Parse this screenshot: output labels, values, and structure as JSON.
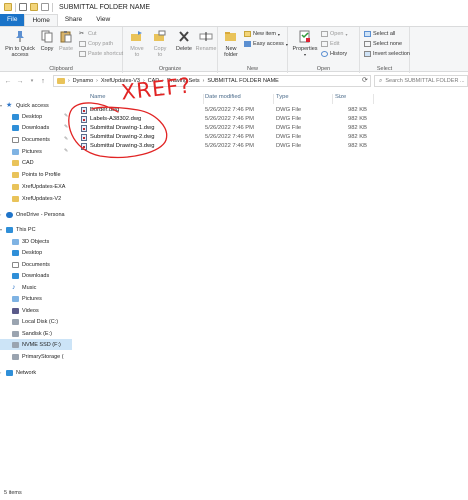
{
  "window": {
    "title": "SUBMITTAL FOLDER NAME"
  },
  "tabs": [
    {
      "label": "File"
    },
    {
      "label": "Home"
    },
    {
      "label": "Share"
    },
    {
      "label": "View"
    }
  ],
  "ribbon": {
    "clipboard": {
      "group_label": "Clipboard",
      "pin_label_1": "Pin to Quick",
      "pin_label_2": "access",
      "copy_label": "Copy",
      "paste_label": "Paste",
      "cut_label": "Cut",
      "copy_path_label": "Copy path",
      "paste_shortcut_label": "Paste shortcut"
    },
    "organize": {
      "group_label": "Organize",
      "move_to_1": "Move",
      "move_to_2": "to",
      "copy_to_1": "Copy",
      "copy_to_2": "to",
      "delete_label": "Delete",
      "rename_label": "Rename"
    },
    "new": {
      "group_label": "New",
      "new_folder_1": "New",
      "new_folder_2": "folder",
      "new_item_label": "New item",
      "easy_access_label": "Easy access"
    },
    "open": {
      "group_label": "Open",
      "properties_label": "Properties",
      "open_label": "Open",
      "edit_label": "Edit",
      "history_label": "History"
    },
    "select": {
      "group_label": "Select",
      "select_all_label": "Select all",
      "select_none_label": "Select none",
      "invert_selection_label": "Invert selection"
    }
  },
  "address": {
    "crumbs": [
      "Dynamo",
      "XrefUpdates-V3",
      "CAD",
      "Drawing Sets",
      "SUBMITTAL FOLDER NAME"
    ],
    "search_placeholder": "Search SUBMITTAL FOLDER ..."
  },
  "columns": {
    "name": "Name",
    "date": "Date modified",
    "type": "Type",
    "size": "Size"
  },
  "files": [
    {
      "name": "Border.dwg",
      "date": "5/26/2022 7:46 PM",
      "type": "DWG File",
      "size": "982 KB"
    },
    {
      "name": "Labels-A38302.dwg",
      "date": "5/26/2022 7:46 PM",
      "type": "DWG File",
      "size": "982 KB"
    },
    {
      "name": "Submittal Drawing-1.dwg",
      "date": "5/26/2022 7:46 PM",
      "type": "DWG File",
      "size": "982 KB"
    },
    {
      "name": "Submittal Drawing-2.dwg",
      "date": "5/26/2022 7:46 PM",
      "type": "DWG File",
      "size": "982 KB"
    },
    {
      "name": "Submittal Drawing-3.dwg",
      "date": "5/26/2022 7:46 PM",
      "type": "DWG File",
      "size": "982 KB"
    }
  ],
  "nav": {
    "quick_access": "Quick access",
    "desktop": "Desktop",
    "downloads": "Downloads",
    "documents": "Documents",
    "pictures": "Pictures",
    "cad": "CAD",
    "points_to_profile": "Points to Profile",
    "xref_exa": "XrefUpdates-EXA",
    "xref_v2": "XrefUpdates-V2",
    "onedrive": "OneDrive - Persona",
    "this_pc": "This PC",
    "objects3d": "3D Objects",
    "pc_desktop": "Desktop",
    "pc_documents": "Documents",
    "pc_downloads": "Downloads",
    "music": "Music",
    "pc_pictures": "Pictures",
    "videos": "Videos",
    "local_disk": "Local Disk (C:)",
    "sandisk": "Sandisk (E:)",
    "nvme": "NVME SSD (F:)",
    "primary_storage": "PrimaryStorage (",
    "network": "Network"
  },
  "annotation": {
    "text": "XREF?",
    "color": "#e12424"
  },
  "status": {
    "items": "5 items"
  }
}
